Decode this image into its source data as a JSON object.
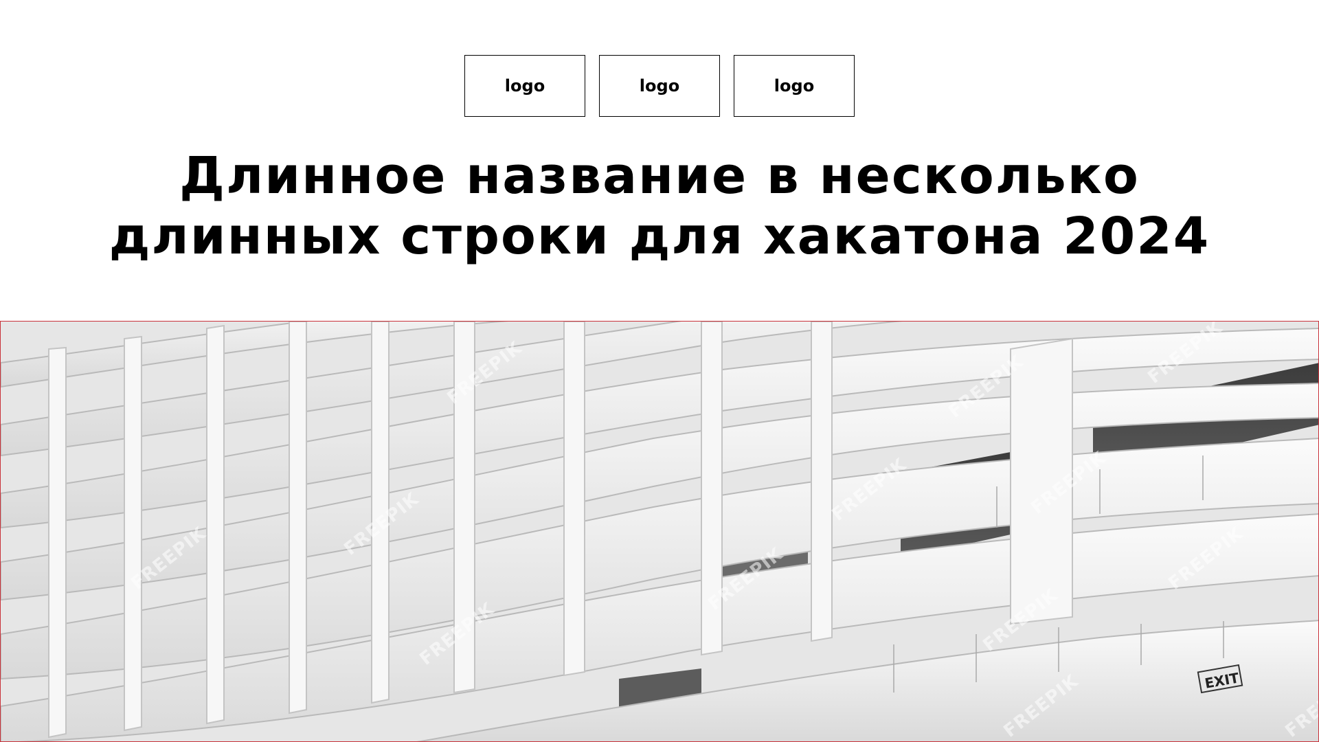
{
  "logos": [
    "logo",
    "logo",
    "logo"
  ],
  "title": {
    "line1": "Длинное название в несколько",
    "line2": "длинных строки для хакатона 2024"
  },
  "hero": {
    "exit_sign": "EXIT",
    "watermark": "FREEPIK"
  },
  "colors": {
    "hero_border": "#c9323a",
    "text": "#000000",
    "background": "#ffffff"
  }
}
